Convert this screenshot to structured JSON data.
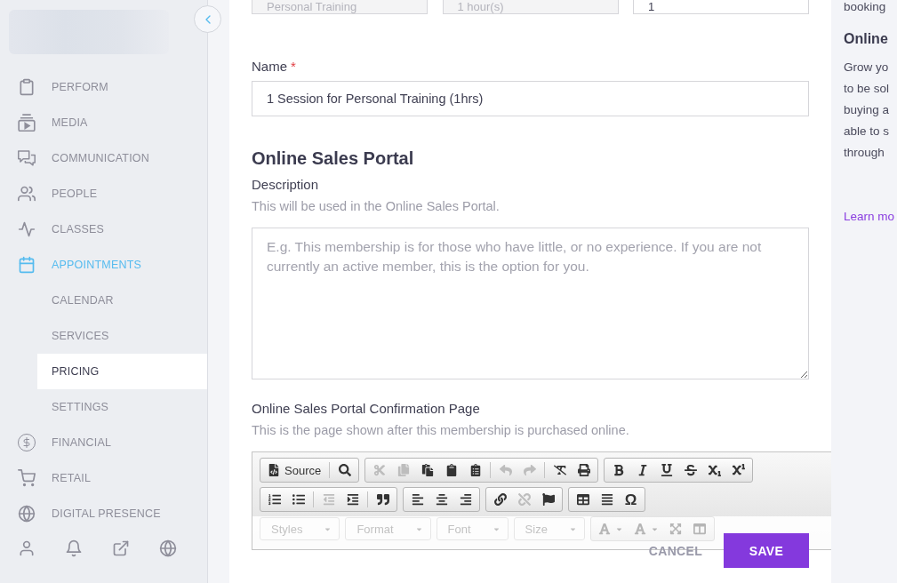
{
  "sidebar": {
    "items": [
      {
        "label": "PERFORM",
        "selected": false
      },
      {
        "label": "MEDIA",
        "selected": false
      },
      {
        "label": "COMMUNICATION",
        "selected": false
      },
      {
        "label": "PEOPLE",
        "selected": false
      },
      {
        "label": "CLASSES",
        "selected": false
      },
      {
        "label": "APPOINTMENTS",
        "selected": true,
        "children": [
          {
            "label": "CALENDAR",
            "selected": false
          },
          {
            "label": "SERVICES",
            "selected": false
          },
          {
            "label": "PRICING",
            "selected": true
          },
          {
            "label": "SETTINGS",
            "selected": false
          }
        ]
      },
      {
        "label": "FINANCIAL",
        "selected": false
      },
      {
        "label": "RETAIL",
        "selected": false
      },
      {
        "label": "DIGITAL PRESENCE",
        "selected": false
      }
    ]
  },
  "top_fields": [
    {
      "value": "Personal Training",
      "disabled": true
    },
    {
      "value": "1 hour(s)",
      "disabled": true
    },
    {
      "value": "1",
      "disabled": false
    }
  ],
  "name_field": {
    "label": "Name",
    "required_mark": "*",
    "value": "1 Session for Personal Training (1hrs)"
  },
  "section_heading": "Online Sales Portal",
  "description": {
    "label": "Description",
    "hint": "This will be used in the Online Sales Portal.",
    "placeholder": "E.g. This membership is for those who have little, or no experience. If you are not currently an active member, this is the option for you."
  },
  "confirmation_page": {
    "label": "Online Sales Portal Confirmation Page",
    "hint": "This is the page shown after this membership is purchased online.",
    "editor": {
      "toolbar": [
        {
          "faded": false,
          "groups": [
            {
              "kind": "buttons",
              "sections": [
                [
                  {
                    "kind": "source",
                    "label": "Source",
                    "disabled": false
                  }
                ],
                [
                  {
                    "kind": "preview",
                    "disabled": false
                  }
                ]
              ]
            },
            {
              "kind": "buttons",
              "sections": [
                [
                  {
                    "kind": "cut",
                    "disabled": true
                  },
                  {
                    "kind": "copy",
                    "disabled": true
                  },
                  {
                    "kind": "paste",
                    "disabled": false
                  },
                  {
                    "kind": "pastetext",
                    "disabled": false
                  },
                  {
                    "kind": "pasteword",
                    "disabled": false
                  }
                ],
                [
                  {
                    "kind": "undo",
                    "disabled": true
                  },
                  {
                    "kind": "redo",
                    "disabled": true
                  }
                ],
                [
                  {
                    "kind": "removeformat",
                    "disabled": false
                  },
                  {
                    "kind": "print",
                    "disabled": false
                  }
                ]
              ]
            },
            {
              "kind": "buttons",
              "sections": [
                [
                  {
                    "kind": "bold",
                    "disabled": false
                  },
                  {
                    "kind": "italic",
                    "disabled": false
                  },
                  {
                    "kind": "underline",
                    "disabled": false
                  },
                  {
                    "kind": "strike",
                    "disabled": false
                  },
                  {
                    "kind": "subscript",
                    "disabled": false
                  },
                  {
                    "kind": "superscript",
                    "disabled": false
                  }
                ]
              ]
            }
          ]
        },
        {
          "faded": false,
          "groups": [
            {
              "kind": "buttons",
              "sections": [
                [
                  {
                    "kind": "numbered",
                    "disabled": false
                  },
                  {
                    "kind": "bulleted",
                    "disabled": false
                  }
                ],
                [
                  {
                    "kind": "outdent",
                    "disabled": true
                  },
                  {
                    "kind": "indent",
                    "disabled": false
                  }
                ],
                [
                  {
                    "kind": "blockquote",
                    "disabled": false
                  }
                ]
              ]
            },
            {
              "kind": "buttons",
              "sections": [
                [
                  {
                    "kind": "alignleft",
                    "disabled": false
                  },
                  {
                    "kind": "aligncenter",
                    "disabled": false
                  },
                  {
                    "kind": "alignright",
                    "disabled": false
                  }
                ]
              ]
            },
            {
              "kind": "buttons",
              "sections": [
                [
                  {
                    "kind": "link",
                    "disabled": false
                  },
                  {
                    "kind": "unlink",
                    "disabled": true
                  },
                  {
                    "kind": "anchor",
                    "disabled": false
                  }
                ]
              ]
            },
            {
              "kind": "buttons",
              "sections": [
                [
                  {
                    "kind": "table",
                    "disabled": false
                  },
                  {
                    "kind": "hline",
                    "disabled": false
                  },
                  {
                    "kind": "specialchar",
                    "label": "Ω",
                    "disabled": false
                  }
                ]
              ]
            }
          ]
        },
        {
          "faded": true,
          "groups": [
            {
              "kind": "combo",
              "label": "Styles"
            },
            {
              "kind": "combo",
              "label": "Format"
            },
            {
              "kind": "combo",
              "label": "Font"
            },
            {
              "kind": "combo",
              "label": "Size"
            },
            {
              "kind": "buttons",
              "sections": [
                [
                  {
                    "kind": "textcolor",
                    "disabled": false
                  },
                  {
                    "kind": "bgcolor",
                    "disabled": false
                  },
                  {
                    "kind": "maximize",
                    "disabled": false
                  },
                  {
                    "kind": "showblocks",
                    "disabled": false
                  }
                ]
              ]
            }
          ]
        }
      ]
    }
  },
  "actions": [
    {
      "kind": "cancel",
      "label": "CANCEL"
    },
    {
      "kind": "save",
      "label": "SAVE"
    }
  ],
  "help_panel": {
    "previous_text": "booking",
    "heading": "Online",
    "lines": [
      "Grow yo",
      "to be sol",
      "buying a",
      "able to s",
      "through"
    ],
    "link": "Learn mo"
  }
}
